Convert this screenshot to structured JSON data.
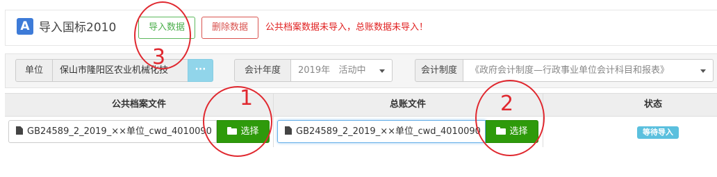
{
  "header": {
    "logo_letter": "A",
    "title": "导入国标2010",
    "import_label": "导入数据",
    "delete_label": "删除数据",
    "warning": "公共档案数据未导入，总账数据未导入！"
  },
  "filters": {
    "unit_label": "单位",
    "unit_value": "保山市隆阳区农业机械化技",
    "more_label": "···",
    "year_label": "会计年度",
    "year_value": "2019年   活动中",
    "system_label": "会计制度",
    "system_value": "《政府会计制度—行政事业单位会计科目和报表》"
  },
  "table": {
    "headers": [
      "公共档案文件",
      "总账文件",
      "状态"
    ],
    "row": {
      "public_file": "GB24589_2_2019_××单位_cwd_4010090",
      "ledger_file": "GB24589_2_2019_××单位_cwd_4010090",
      "choose_label": "选择",
      "status": "等待导入"
    }
  },
  "annotations": [
    "3",
    "1",
    "2"
  ],
  "colors": {
    "brand": "#3d7bd8",
    "success": "#2e9a0b",
    "danger": "#d9534f",
    "info": "#5bc0de",
    "annotation": "#e0282f"
  }
}
